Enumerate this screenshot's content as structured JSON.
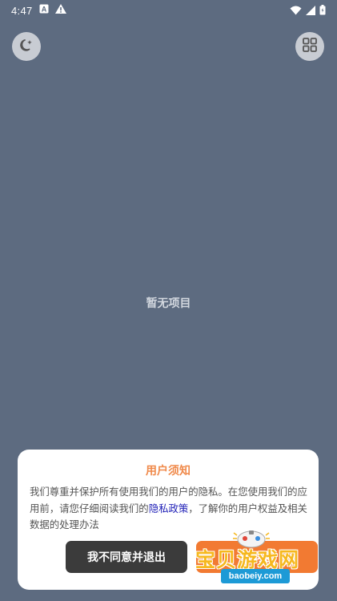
{
  "status_bar": {
    "time": "4:47",
    "left_icons": [
      "a-box-icon",
      "warning-icon"
    ],
    "right_icons": [
      "wifi-icon",
      "signal-icon",
      "battery-icon"
    ]
  },
  "toolbar": {
    "left_button_icon": "moon-sparkle-icon",
    "right_button_icon": "grid-icon"
  },
  "main": {
    "empty_text": "暂无项目"
  },
  "dialog": {
    "title": "用户须知",
    "body_before_link": "我们尊重并保护所有使用我们的用户的隐私。在您使用我们的应用前，请您仔细阅读我们的",
    "link_text": "隐私政策",
    "body_after_link": "，了解你的用户权益及相关数据的处理办法",
    "decline_label": "我不同意并退出",
    "accept_label": "我同意"
  },
  "watermark": {
    "text": "宝贝游戏网",
    "url": "baobeiy.com"
  },
  "colors": {
    "background": "#5d6b80",
    "accent": "#f27a32",
    "title": "#f08a4b",
    "link": "#2323b8",
    "decline_button": "#3b3b3b"
  }
}
